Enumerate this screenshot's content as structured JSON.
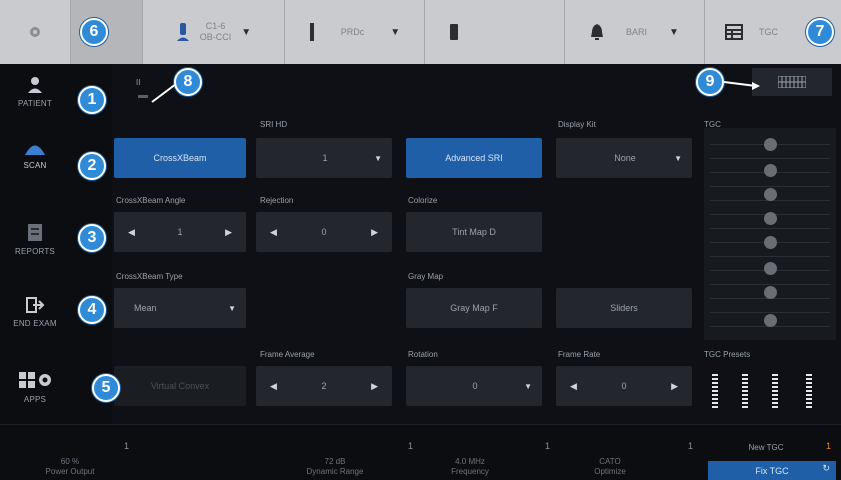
{
  "topbar": {
    "probe_name": "C1-6",
    "probe_sub": "OB-CCI",
    "preset": "PRDc",
    "button_right": "BARI",
    "tgc_label": "TGC"
  },
  "sidebar": {
    "items": [
      {
        "label": "PATIENT",
        "icon": "patient-icon"
      },
      {
        "label": "SCAN",
        "icon": "scan-icon"
      },
      {
        "label": "REPORTS",
        "icon": "reports-icon"
      },
      {
        "label": "END EXAM",
        "icon": "end-exam-icon"
      },
      {
        "label": "APPS",
        "icon": "apps-icon"
      }
    ]
  },
  "page_indicator": "II",
  "callouts": [
    "1",
    "2",
    "3",
    "4",
    "5",
    "6",
    "7",
    "8",
    "9"
  ],
  "controls": {
    "crossxbeam": "CrossXBeam",
    "sri_hd_label": "SRI HD",
    "sri_hd_value": "1",
    "advanced_sri": "Advanced SRI",
    "display_kit_label": "Display Kit",
    "display_kit_value": "None",
    "tgc_header": "TGC",
    "crossxbeam_angle_label": "CrossXBeam Angle",
    "crossxbeam_angle_value": "1",
    "rejection_label": "Rejection",
    "rejection_value": "0",
    "colorize_label": "Colorize",
    "colorize_value": "Tint Map D",
    "crossxbeam_type_label": "CrossXBeam Type",
    "crossxbeam_type_value": "Mean",
    "gray_map_label": "Gray Map",
    "gray_map_value": "Gray Map F",
    "gray_map_extra": "Sliders",
    "dim_button": "Virtual Convex",
    "frame_average_label": "Frame Average",
    "frame_average_value": "2",
    "rotation_label": "Rotation",
    "rotation_value": "0",
    "frame_rate_label": "Frame Rate",
    "frame_rate_value": "0",
    "tgc_presets_label": "TGC Presets"
  },
  "bottom": {
    "power_value": "60 %",
    "power_label": "Power Output",
    "dynamic_value": "72 dB",
    "dynamic_label": "Dynamic Range",
    "freq_value": "4.0 MHz",
    "freq_label": "Frequency",
    "optimize_value": "CATO",
    "optimize_label": "Optimize",
    "new_tgc": "New TGC",
    "fix_tgc": "Fix TGC",
    "marker": "1"
  },
  "colors": {
    "accent": "#2f8ad8",
    "button_blue": "#1f5fa8",
    "topbar": "#c9cbce"
  }
}
